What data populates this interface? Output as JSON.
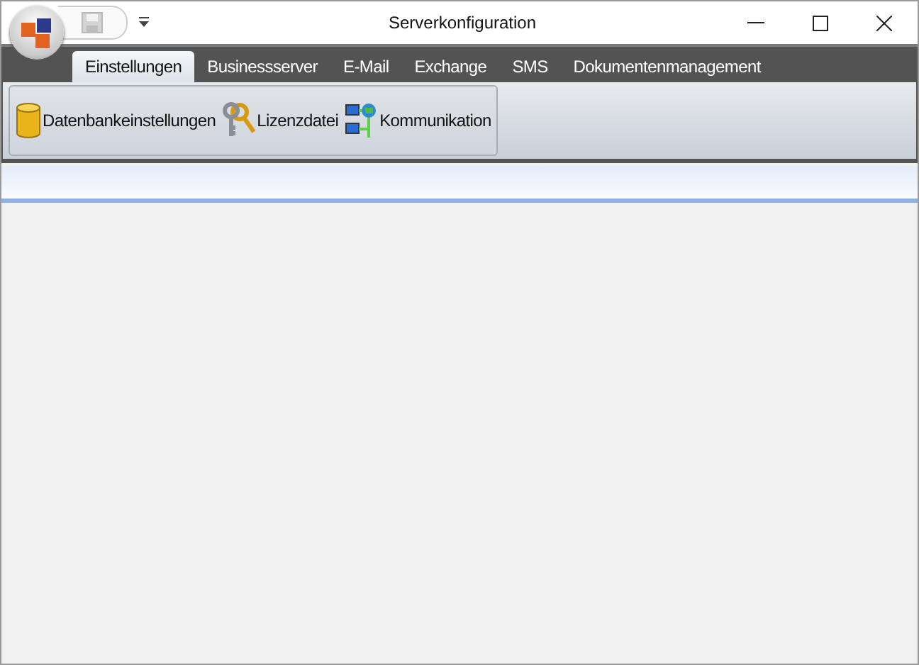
{
  "window": {
    "title": "Serverkonfiguration"
  },
  "tabs": [
    {
      "label": "Einstellungen",
      "selected": true
    },
    {
      "label": "Businessserver",
      "selected": false
    },
    {
      "label": "E-Mail",
      "selected": false
    },
    {
      "label": "Exchange",
      "selected": false
    },
    {
      "label": "SMS",
      "selected": false
    },
    {
      "label": "Dokumentenmanagement",
      "selected": false
    }
  ],
  "ribbon_items": [
    {
      "label": "Datenbankeinstellungen",
      "kind": "database"
    },
    {
      "label": "Lizenzdatei",
      "kind": "keys"
    },
    {
      "label": "Kommunikation",
      "kind": "network"
    }
  ]
}
